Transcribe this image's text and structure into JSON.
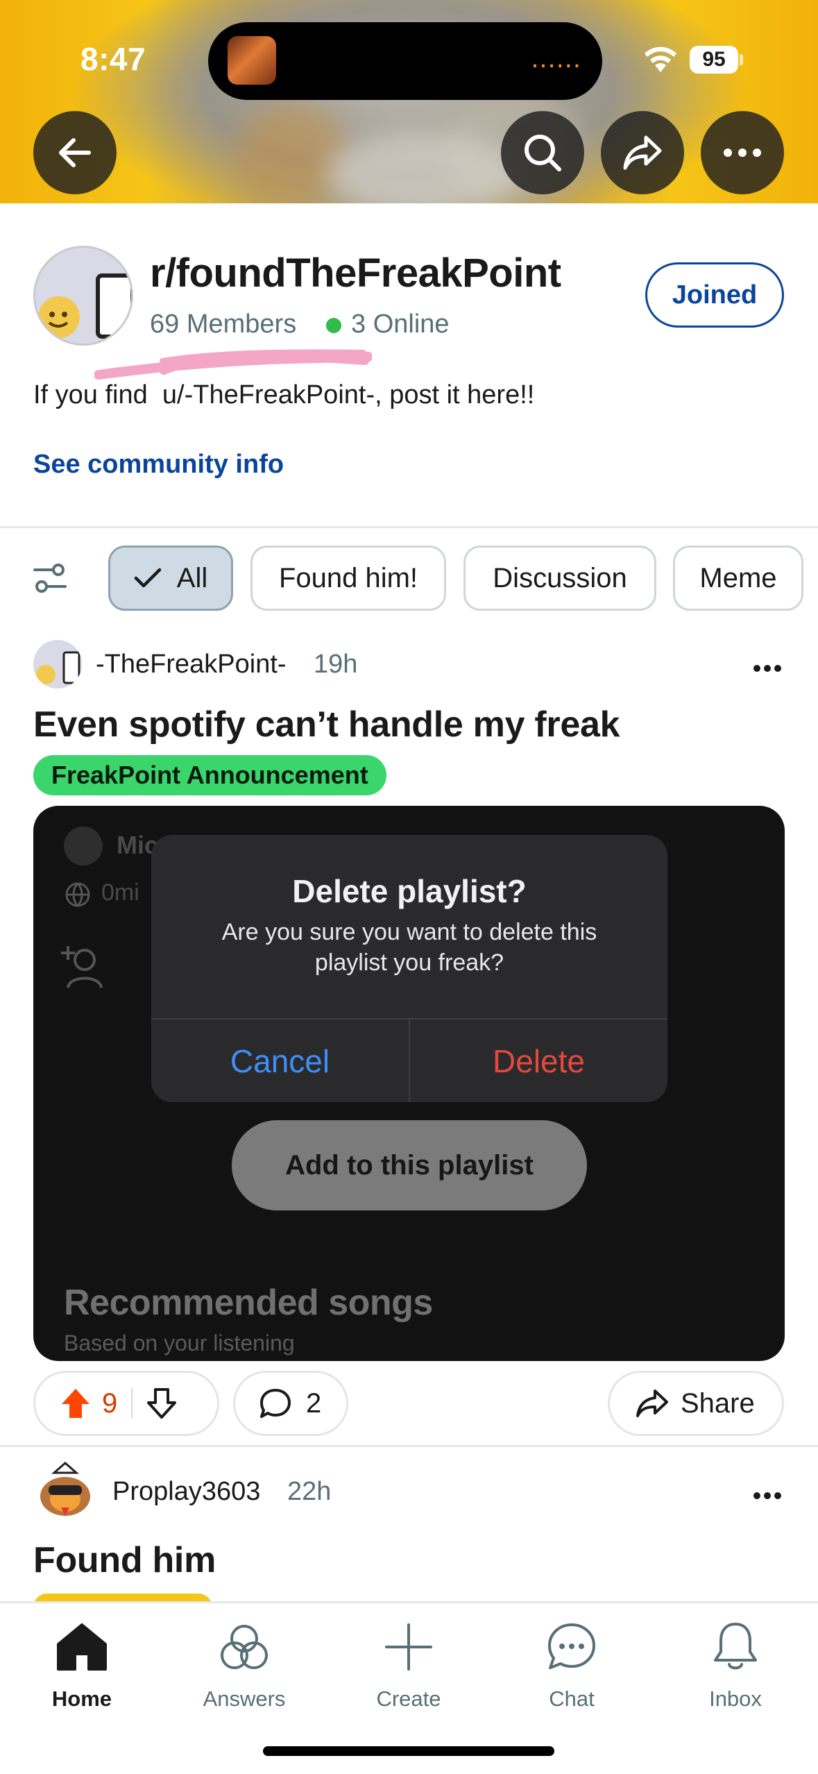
{
  "status_bar": {
    "time": "8:47",
    "battery": "95",
    "island_indicator": "......"
  },
  "header_buttons": {
    "back_icon": "arrow-left-icon",
    "search_icon": "search-icon",
    "share_icon": "share-arrow-icon",
    "more_icon": "ellipsis-icon"
  },
  "community": {
    "name": "r/foundTheFreakPoint",
    "members": "69 Members",
    "online": "3 Online",
    "joined_label": "Joined",
    "description": "If you find  u/-TheFreakPoint-, post it here!!",
    "info_link": "See community info"
  },
  "flair_filter": {
    "chips": [
      "All",
      "Found him!",
      "Discussion",
      "Meme"
    ],
    "active": "All"
  },
  "posts": [
    {
      "author": "-TheFreakPoint-",
      "time": "19h",
      "title": "Even spotify can’t handle my freak",
      "flair": "FreakPoint Announcement",
      "media": {
        "bg_profile_initial": "Mic",
        "bg_duration": "0mi",
        "dialog_title": "Delete playlist?",
        "dialog_message": "Are you sure you want to delete this playlist you freak?",
        "cancel_label": "Cancel",
        "delete_label": "Delete",
        "add_label": "Add to this playlist",
        "recommended_title": "Recommended songs",
        "recommended_sub": "Based on your listening"
      },
      "votes": "9",
      "comments": "2",
      "share_label": "Share"
    },
    {
      "author": "Proplay3603",
      "time": "22h",
      "title": "Found him"
    }
  ],
  "tabbar": {
    "tabs": [
      {
        "label": "Home",
        "icon": "home-icon"
      },
      {
        "label": "Answers",
        "icon": "answers-icon"
      },
      {
        "label": "Create",
        "icon": "plus-icon"
      },
      {
        "label": "Chat",
        "icon": "chat-bubble-icon"
      },
      {
        "label": "Inbox",
        "icon": "bell-icon"
      }
    ],
    "active": "Home"
  },
  "colors": {
    "accent_blue": "#0a449b",
    "upvote_orange": "#ff4500",
    "flair_green": "#3ad56b",
    "dialog_cancel": "#3e8ef7",
    "dialog_delete": "#e5483c"
  }
}
